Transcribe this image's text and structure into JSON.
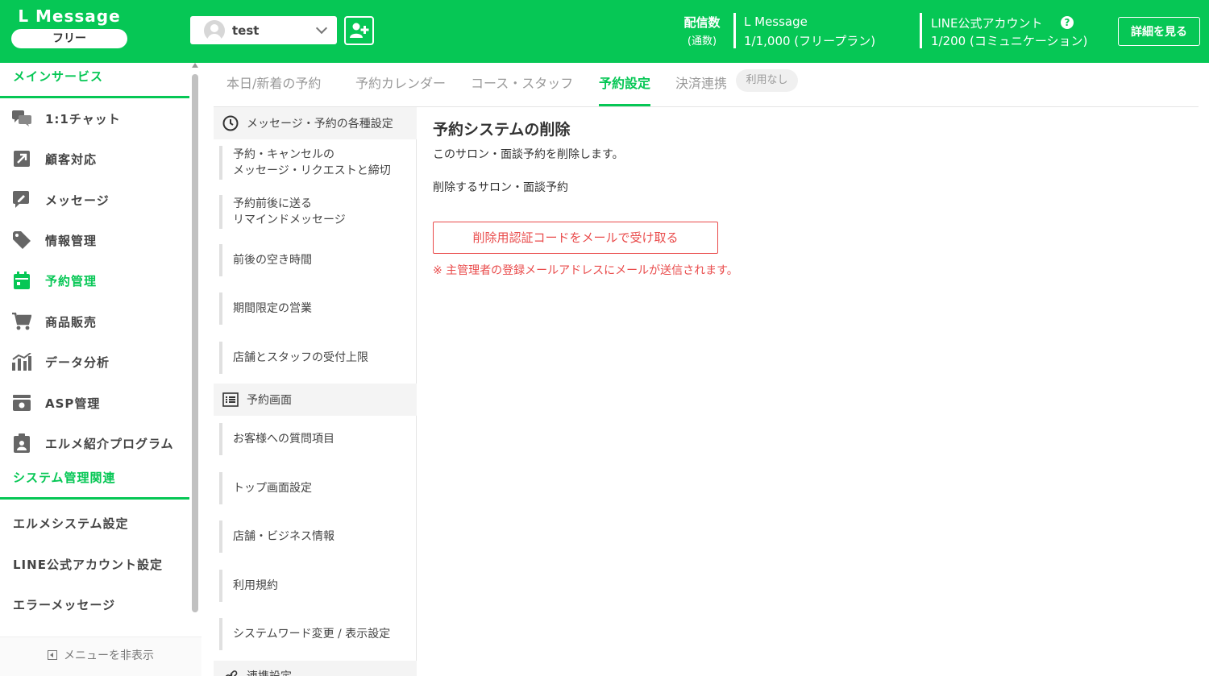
{
  "header": {
    "logo_title": "L Message",
    "plan": "フリー",
    "account_name": "test",
    "stat1_label": "配信数",
    "stat1_sub": "(通数)",
    "stat1_name": "L Message",
    "stat1_value": "1/1,000 (フリープラン)",
    "stat2_name": "LINE公式アカウント",
    "stat2_value": "1/200 (コミュニケーション)",
    "help": "?",
    "detail_button": "詳細を見る",
    "brand_color": "#06c755"
  },
  "sidebar": {
    "main_section": "メインサービス",
    "items": [
      {
        "label": "1:1チャット",
        "icon": "chat-icon"
      },
      {
        "label": "顧客対応",
        "icon": "arrow-out-icon"
      },
      {
        "label": "メッセージ",
        "icon": "message-edit-icon"
      },
      {
        "label": "情報管理",
        "icon": "tag-icon"
      },
      {
        "label": "予約管理",
        "icon": "calendar-icon"
      },
      {
        "label": "商品販売",
        "icon": "cart-icon"
      },
      {
        "label": "データ分析",
        "icon": "chart-icon"
      },
      {
        "label": "ASP管理",
        "icon": "wallet-icon"
      },
      {
        "label": "エルメ紹介プログラム",
        "icon": "clipboard-user-icon"
      }
    ],
    "system_section": "システム管理関連",
    "system_items": [
      "エルメシステム設定",
      "LINE公式アカウント設定",
      "エラーメッセージ"
    ],
    "hide_menu": "メニューを非表示"
  },
  "tabs": [
    {
      "label": "本日/新着の予約"
    },
    {
      "label": "予約カレンダー"
    },
    {
      "label": "コース・スタッフ"
    },
    {
      "label": "予約設定"
    },
    {
      "label": "決済連携"
    }
  ],
  "tab_badge": "利用なし",
  "submenu": {
    "head1": "メッセージ・予約の各種設定",
    "items1": [
      [
        "予約・キャンセルの",
        "メッセージ・リクエストと締切"
      ],
      [
        "予約前後に送る",
        "リマインドメッセージ"
      ],
      [
        "前後の空き時間"
      ],
      [
        "期間限定の営業"
      ],
      [
        "店舗とスタッフの受付上限"
      ]
    ],
    "head2": "予約画面",
    "items2": [
      [
        "お客様への質問項目"
      ],
      [
        "トップ画面設定"
      ],
      [
        "店舗・ビジネス情報"
      ],
      [
        "利用規約"
      ],
      [
        "システムワード変更 / 表示設定"
      ]
    ],
    "head3": "連携設定"
  },
  "main": {
    "title": "予約システムの削除",
    "description": "このサロン・面談予約を削除します。",
    "label": "削除するサロン・面談予約",
    "button": "削除用認証コードをメールで受け取る",
    "note": "※ 主管理者の登録メールアドレスにメールが送信されます。",
    "danger_color": "#e94b4b"
  }
}
